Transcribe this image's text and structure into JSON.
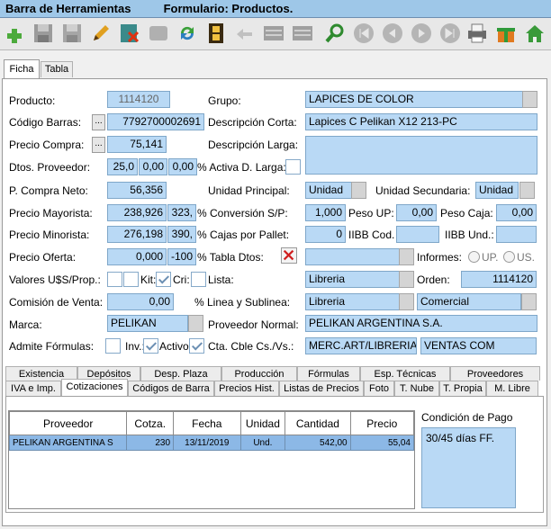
{
  "window": {
    "title": "Barra de Herramientas",
    "subtitle": "Formulario: Productos."
  },
  "toolbar": {
    "icons": [
      "add-icon",
      "save-icon",
      "save-disabled-icon",
      "edit-icon",
      "delete-icon",
      "undo-icon",
      "refresh-icon",
      "film-icon",
      "back-icon",
      "list-icon",
      "list2-icon",
      "search-icon",
      "first-icon",
      "prev-icon",
      "next-icon",
      "last-icon",
      "print-icon",
      "gift-icon",
      "home-icon"
    ]
  },
  "main_tabs": [
    "Ficha",
    "Tabla"
  ],
  "form": {
    "producto_label": "Producto:",
    "producto": "1114120",
    "grupo_label": "Grupo:",
    "grupo": "LAPICES DE COLOR",
    "codigo_barras_label": "Código Barras:",
    "codigo_barras": "7792700002691",
    "descripcion_corta_label": "Descripción Corta:",
    "descripcion_corta": "Lapices C Pelikan X12 213-PC",
    "precio_compra_label": "Precio Compra:",
    "precio_compra": "75,141",
    "descripcion_larga_label": "Descripción Larga:",
    "descripcion_larga": "",
    "dtos_proveedor_label": "Dtos. Proveedor:",
    "dto1": "25,0",
    "dto2": "0,00",
    "dto3": "0,00",
    "activa_dlarga_label": "% Activa D. Larga:",
    "p_compra_neto_label": "P. Compra Neto:",
    "p_compra_neto": "56,356",
    "unidad_principal_label": "Unidad Principal:",
    "unidad_principal": "Unidad",
    "unidad_secundaria_label": "Unidad Secundaria:",
    "unidad_secundaria": "Unidad",
    "precio_mayorista_label": "Precio Mayorista:",
    "precio_mayorista": "238,926",
    "precio_mayorista_pct": "323,",
    "conversion_label": "% Conversión S/P:",
    "conversion": "1,000",
    "peso_up_label": "Peso UP:",
    "peso_up": "0,00",
    "peso_caja_label": "Peso Caja:",
    "peso_caja": "0,00",
    "precio_minorista_label": "Precio Minorista:",
    "precio_minorista": "276,198",
    "precio_minorista_pct": "390,",
    "cajas_pallet_label": "% Cajas por Pallet:",
    "cajas_pallet": "0",
    "iibb_cod_label": "IIBB Cod.",
    "iibb_cod": "",
    "iibb_und_label": "IIBB Und.:",
    "iibb_und": "",
    "precio_oferta_label": "Precio Oferta:",
    "precio_oferta": "0,000",
    "precio_oferta_pct": "-100",
    "tabla_dtos_label": "% Tabla Dtos:",
    "tabla_dtos": "",
    "informes_label": "Informes:",
    "informes_up": "UP.",
    "informes_us": "US.",
    "valores_label": "Valores U$S/Prop.:",
    "kit_label": "Kit:",
    "cri_label": "Cri:",
    "lista_label": "Lista:",
    "lista": "Libreria",
    "orden_label": "Orden:",
    "orden": "1114120",
    "comision_label": "Comisión de Venta:",
    "comision": "0,00",
    "linea_label": "% Linea y Sublinea:",
    "linea": "Libreria",
    "sublinea": "Comercial",
    "marca_label": "Marca:",
    "marca": "PELIKAN",
    "proveedor_normal_label": "Proveedor Normal:",
    "proveedor_normal": "PELIKAN ARGENTINA S.A.",
    "admite_formulas_label": "Admite Fórmulas:",
    "inv_label": "Inv.:",
    "activo_label": "Activo",
    "cta_cble_label": "Cta. Cble Cs./Vs.:",
    "cta_cble1": "MERC.ART/LIBRERIA",
    "cta_cble2": "VENTAS COM"
  },
  "sub_tabs_row1": [
    "Existencia",
    "Depósitos",
    "Desp. Plaza",
    "Producción",
    "Fórmulas",
    "Esp. Técnicas",
    "Proveedores"
  ],
  "sub_tabs_row2": [
    "IVA e Imp.",
    "Cotizaciones",
    "Códigos de Barra",
    "Precios Hist.",
    "Listas de Precios",
    "Foto",
    "T. Nube",
    "T. Propia",
    "M. Libre"
  ],
  "grid": {
    "headers": [
      "Proveedor",
      "Cotza.",
      "Fecha",
      "Unidad",
      "Cantidad",
      "Precio"
    ],
    "rows": [
      [
        "PELIKAN ARGENTINA S",
        "230",
        "13/11/2019",
        "Und.",
        "542,00",
        "55,04"
      ]
    ]
  },
  "condicion": {
    "label": "Condición de Pago",
    "value": "30/45 días FF."
  }
}
